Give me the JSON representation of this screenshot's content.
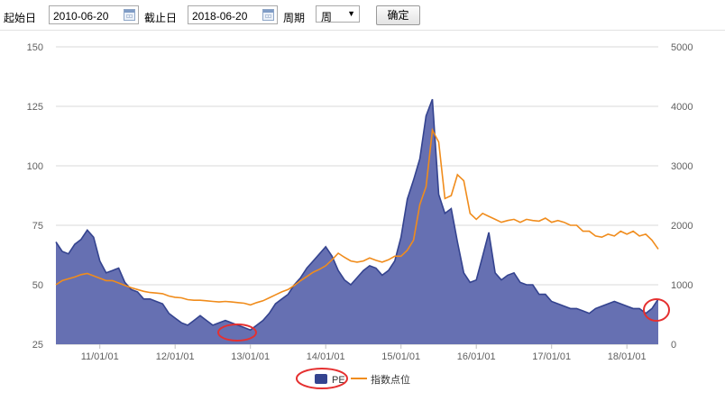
{
  "toolbar": {
    "start_label": "起始日",
    "start_value": "2010-06-20",
    "end_label": "截止日",
    "end_value": "2018-06-20",
    "period_label": "周期",
    "period_value": "周",
    "confirm_label": "确定"
  },
  "chart_data": {
    "type": "area",
    "x": [
      "2010-06",
      "2010-07",
      "2010-08",
      "2010-09",
      "2010-10",
      "2010-11",
      "2010-12",
      "2011-01",
      "2011-02",
      "2011-03",
      "2011-04",
      "2011-05",
      "2011-06",
      "2011-07",
      "2011-08",
      "2011-09",
      "2011-10",
      "2011-11",
      "2011-12",
      "2012-01",
      "2012-02",
      "2012-03",
      "2012-04",
      "2012-05",
      "2012-06",
      "2012-07",
      "2012-08",
      "2012-09",
      "2012-10",
      "2012-11",
      "2012-12",
      "2013-01",
      "2013-02",
      "2013-03",
      "2013-04",
      "2013-05",
      "2013-06",
      "2013-07",
      "2013-08",
      "2013-09",
      "2013-10",
      "2013-11",
      "2013-12",
      "2014-01",
      "2014-02",
      "2014-03",
      "2014-04",
      "2014-05",
      "2014-06",
      "2014-07",
      "2014-08",
      "2014-09",
      "2014-10",
      "2014-11",
      "2014-12",
      "2015-01",
      "2015-02",
      "2015-03",
      "2015-04",
      "2015-05",
      "2015-06",
      "2015-07",
      "2015-08",
      "2015-09",
      "2015-10",
      "2015-11",
      "2015-12",
      "2016-01",
      "2016-02",
      "2016-03",
      "2016-04",
      "2016-05",
      "2016-06",
      "2016-07",
      "2016-08",
      "2016-09",
      "2016-10",
      "2016-11",
      "2016-12",
      "2017-01",
      "2017-02",
      "2017-03",
      "2017-04",
      "2017-05",
      "2017-06",
      "2017-07",
      "2017-08",
      "2017-09",
      "2017-10",
      "2017-11",
      "2017-12",
      "2018-01",
      "2018-02",
      "2018-03",
      "2018-04",
      "2018-05",
      "2018-06"
    ],
    "series": [
      {
        "name": "PE",
        "color": "#34438f",
        "fill": "#6670b2",
        "axis": "left",
        "values": [
          68,
          64,
          63,
          67,
          69,
          73,
          70,
          60,
          55,
          56,
          57,
          51,
          48,
          47,
          44,
          44,
          43,
          42,
          38,
          36,
          34,
          33,
          35,
          37,
          35,
          33,
          34,
          35,
          34,
          33,
          32,
          31,
          33,
          35,
          38,
          42,
          44,
          46,
          50,
          53,
          57,
          60,
          63,
          66,
          62,
          56,
          52,
          50,
          53,
          56,
          58,
          57,
          54,
          56,
          60,
          70,
          86,
          94,
          103,
          121,
          128,
          88,
          80,
          82,
          68,
          55,
          51,
          52,
          62,
          72,
          55,
          52,
          54,
          55,
          51,
          50,
          50,
          46,
          46,
          43,
          42,
          41,
          40,
          40,
          39,
          38,
          40,
          41,
          42,
          43,
          42,
          41,
          40,
          40,
          38,
          40,
          44
        ]
      },
      {
        "name": "指数点位",
        "color": "#f08c1c",
        "axis": "right",
        "values": [
          1000,
          1070,
          1100,
          1130,
          1170,
          1190,
          1150,
          1110,
          1070,
          1070,
          1030,
          990,
          950,
          920,
          890,
          870,
          860,
          850,
          810,
          790,
          780,
          750,
          740,
          740,
          730,
          720,
          710,
          720,
          710,
          700,
          690,
          660,
          700,
          730,
          780,
          830,
          880,
          920,
          990,
          1070,
          1140,
          1210,
          1260,
          1320,
          1420,
          1530,
          1460,
          1400,
          1380,
          1400,
          1450,
          1410,
          1380,
          1420,
          1480,
          1480,
          1580,
          1750,
          2350,
          2650,
          3600,
          3400,
          2450,
          2500,
          2850,
          2750,
          2200,
          2100,
          2200,
          2150,
          2100,
          2050,
          2080,
          2100,
          2050,
          2100,
          2080,
          2070,
          2120,
          2050,
          2080,
          2050,
          2000,
          2000,
          1900,
          1900,
          1820,
          1800,
          1850,
          1820,
          1900,
          1850,
          1900,
          1820,
          1850,
          1750,
          1600
        ]
      }
    ],
    "left_axis": {
      "ticks": [
        "150",
        "125",
        "100",
        "75",
        "50",
        "25"
      ],
      "ylim": [
        25,
        150
      ]
    },
    "right_axis": {
      "ticks": [
        "5000",
        "4000",
        "3000",
        "2000",
        "1000",
        "0"
      ],
      "ylim": [
        0,
        5000
      ]
    },
    "x_ticks": [
      "11/01/01",
      "12/01/01",
      "13/01/01",
      "14/01/01",
      "15/01/01",
      "16/01/01",
      "17/01/01",
      "18/01/01"
    ],
    "grid": true,
    "legend_position": "bottom-center",
    "annotations": [
      "red ellipse around PE low near 13/01/01",
      "red ellipse around PE latest value",
      "red ellipse around PE legend entry"
    ]
  }
}
